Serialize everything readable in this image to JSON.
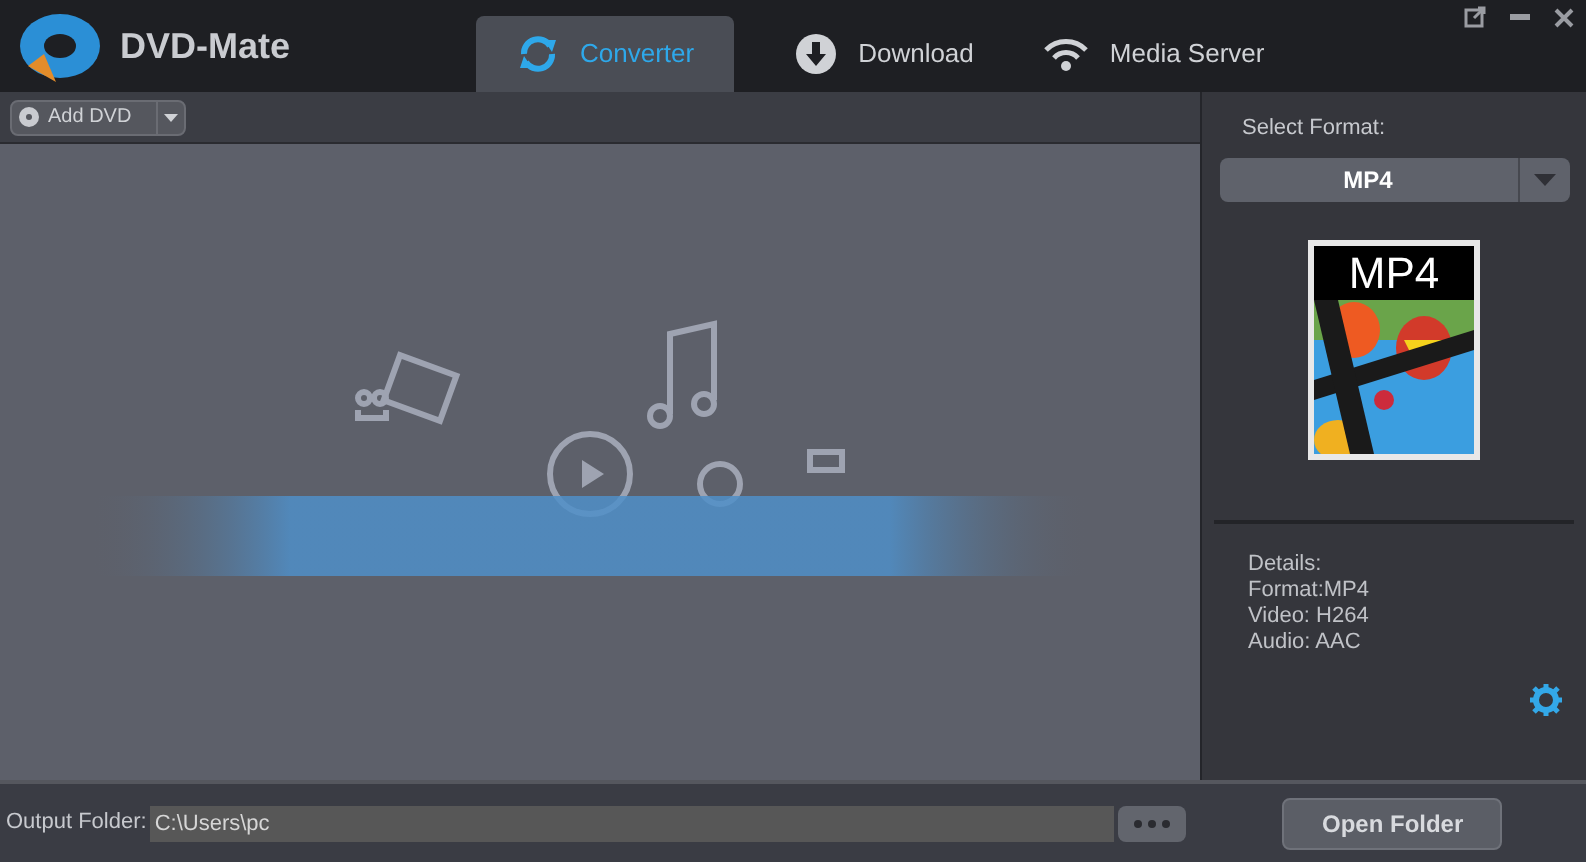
{
  "app": {
    "title": "DVD-Mate"
  },
  "tabs": [
    {
      "label": "Converter",
      "selected": true,
      "kind": "convert"
    },
    {
      "label": "Download",
      "selected": false,
      "kind": "download"
    },
    {
      "label": "Media Server",
      "selected": false,
      "kind": "wifi"
    }
  ],
  "toolbar": {
    "add_button": "Add DVD"
  },
  "format_panel": {
    "label": "Select Format:",
    "value": "MP4",
    "thumbnail_label": "MP4",
    "details": [
      "Details:",
      "Format:MP4",
      "Video: H264",
      "Audio: AAC"
    ]
  },
  "bottom_bar": {
    "output_label": "Output Folder:",
    "output_value": "C:\\Users\\pc",
    "open_button": "Open Folder"
  }
}
